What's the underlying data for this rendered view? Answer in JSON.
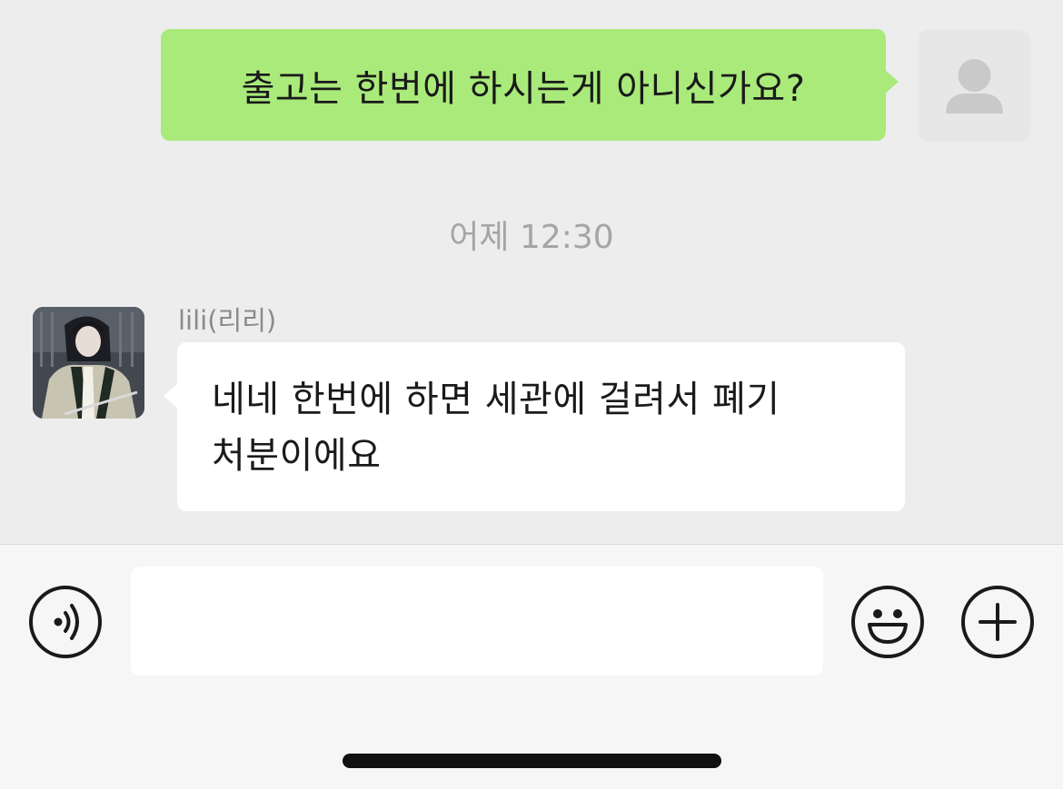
{
  "messages": {
    "outgoing": {
      "text": "출고는 한번에 하시는게 아니신가요?",
      "avatar_icon": "person-placeholder-icon"
    },
    "timestamp": "어제 12:30",
    "incoming": {
      "sender": "lili(리리)",
      "line1": "네네 한번에 하면 세관에 걸려서 폐기",
      "line2": "처분이에요",
      "avatar_icon": "profile-photo"
    }
  },
  "input_bar": {
    "voice_icon": "voice-icon",
    "input_value": "",
    "emoji_icon": "emoji-icon",
    "plus_icon": "plus-icon"
  },
  "colors": {
    "chat_bg": "#ededed",
    "outgoing_bubble": "#a9ea7a",
    "incoming_bubble": "#ffffff",
    "timestamp_text": "#a5a5a5"
  }
}
